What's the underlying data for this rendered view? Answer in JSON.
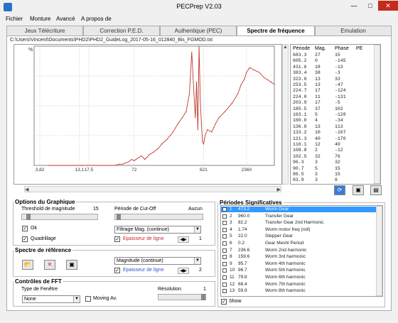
{
  "window": {
    "title": "PECPrep V2.03",
    "min": "—",
    "max": "□",
    "close": "✕"
  },
  "menu": [
    "Fichier",
    "Monture",
    "Avancé",
    "A propos de"
  ],
  "tabs": [
    "Jeux Télécriture",
    "Correction P.E.D.",
    "Authentique (PEC)",
    "Spectre de fréquence",
    "Emulation"
  ],
  "active_tab": 3,
  "path": "C:\\Users\\Vincent\\Documents\\PHD2\\PHD2_GuideLog_2017-05-16_012840_Bis_FGMOD.txt",
  "chart_data": {
    "type": "line",
    "title": "",
    "xlabel": "",
    "ylabel": "",
    "y_top_label": "%",
    "x_scale": "log",
    "x_tick_labels": [
      "3,82",
      "13,1",
      "17,5",
      "72",
      "621",
      "2360"
    ],
    "series": [
      {
        "color": "#c0392b",
        "x": [
          5,
          6,
          8,
          10,
          12,
          14,
          17,
          20,
          24,
          28,
          32,
          36,
          40,
          45,
          50,
          55,
          60,
          66,
          72,
          80,
          90,
          100,
          115,
          130,
          150,
          170,
          200,
          240,
          280,
          320,
          360,
          400,
          430,
          460,
          480,
          500,
          520,
          540,
          560,
          580,
          600,
          621,
          650,
          700,
          800,
          900,
          1000,
          1200,
          1500,
          1800,
          2000,
          2200,
          2360,
          2600,
          3000,
          3500,
          4000,
          4500,
          5000,
          5600
        ],
        "values": [
          0,
          0,
          0,
          0,
          0,
          0,
          0,
          0,
          0,
          0,
          0,
          0,
          0,
          1,
          1,
          2,
          3,
          5,
          4,
          6,
          8,
          5,
          9,
          11,
          14,
          18,
          22,
          28,
          35,
          40,
          45,
          60,
          95,
          60,
          40,
          70,
          30,
          100,
          55,
          35,
          20,
          18,
          25,
          30,
          28,
          35,
          40,
          45,
          52,
          60,
          68,
          72,
          78,
          82,
          80,
          78,
          74,
          72,
          70,
          68
        ]
      }
    ]
  },
  "table": {
    "headers": [
      "Période",
      "Mag.",
      "Phase",
      "PE"
    ],
    "rows": [
      [
        "683.3",
        "27",
        "15",
        ""
      ],
      [
        "605.2",
        "0",
        "-145",
        ""
      ],
      [
        "431.6",
        "18",
        "-13",
        ""
      ],
      [
        "383.4",
        "38",
        "-3",
        ""
      ],
      [
        "323.0",
        "13",
        "33",
        ""
      ],
      [
        "253.5",
        "13",
        "-47",
        ""
      ],
      [
        "224.7",
        "17",
        "-124",
        ""
      ],
      [
        "224.0",
        "11",
        "-131",
        ""
      ],
      [
        "203.9",
        "17",
        "-5",
        ""
      ],
      [
        "185.5",
        "37",
        "102",
        ""
      ],
      [
        "163.1",
        "5",
        "-128",
        ""
      ],
      [
        "160.0",
        "4",
        "-34",
        ""
      ],
      [
        "136.8",
        "13",
        "113",
        ""
      ],
      [
        "133.2",
        "10",
        "-107",
        ""
      ],
      [
        "121.3",
        "40",
        "-170",
        ""
      ],
      [
        "116.1",
        "12",
        "40",
        ""
      ],
      [
        "108.8",
        "2",
        "-12",
        ""
      ],
      [
        "102.5",
        "32",
        "76",
        ""
      ],
      [
        "96.3",
        "3",
        "32",
        ""
      ],
      [
        "90.7",
        "5",
        "15",
        ""
      ],
      [
        "86.5",
        "3",
        "15",
        ""
      ],
      [
        "83.9",
        "3",
        "6",
        ""
      ]
    ]
  },
  "graph_options": {
    "title": "Options du Graphique",
    "threshold_label": "Threshold de magnitude",
    "threshold_value": "15",
    "cutoff_label": "Période de Cut-Off",
    "cutoff_value": "Aucun",
    "ok_label": "Ok",
    "grid_label": "Quadrillage",
    "mode_value": "Filtrage Mag. (continue)",
    "line_thickness_label": "Epaisseur de ligne",
    "line_thickness_value": "1"
  },
  "reference_spectrum": {
    "title": "Spectre de référence",
    "combo_value": "Magnitude (continue)",
    "line_thickness_label": "Epaisseur de ligne",
    "line_thickness_value": "2"
  },
  "fft": {
    "title": "Contrôles de FFT",
    "window_label": "Type de Fenêtre",
    "window_value": "None",
    "moving_avg_label": "Moving Av.",
    "resolution_label": "Résolution",
    "resolution_value": "1"
  },
  "periods": {
    "title": "Périodes Significatives",
    "show_label": "Show",
    "rows": [
      [
        "1",
        "473.2",
        "Worm Gear",
        true
      ],
      [
        "2",
        "960.0",
        "Transfer Gear",
        false
      ],
      [
        "3",
        "82.2",
        "Transfer Gear 2nd Harmonic",
        false
      ],
      [
        "4",
        "1.74",
        "Worm motor freq (roll)",
        false
      ],
      [
        "5",
        "22.0",
        "Stepper Gear",
        false
      ],
      [
        "6",
        "0.2",
        "Gear Meshl Period",
        false
      ],
      [
        "7",
        "236.6",
        "Worm 2nd harmonic",
        false
      ],
      [
        "8",
        "159.6",
        "Worm 3rd harmonic",
        false
      ],
      [
        "9",
        "95.7",
        "Worm 4th harmonic",
        false
      ],
      [
        "10",
        "96.7",
        "Worm 5th harmonic",
        false
      ],
      [
        "11",
        "79.8",
        "Worm 6th harmonic",
        false
      ],
      [
        "12",
        "68.4",
        "Worm 7th harmonic",
        false
      ],
      [
        "13",
        "59.9",
        "Worm 8th harmonic",
        false
      ]
    ]
  }
}
